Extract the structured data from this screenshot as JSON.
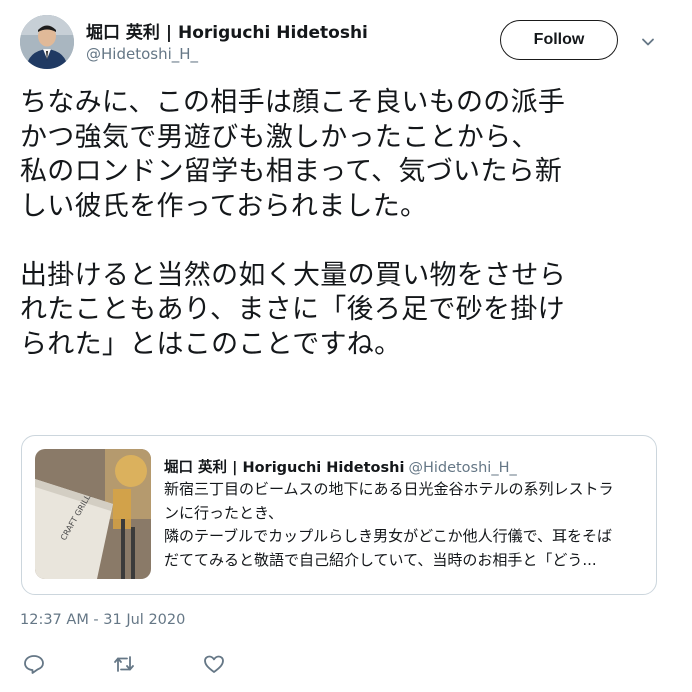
{
  "author": {
    "display_name": "堀口 英利 | Horiguchi Hidetoshi",
    "handle": "@Hidetoshi_H_"
  },
  "follow_label": "Follow",
  "tweet_lines": [
    "ちなみに、この相手は顔こそ良いものの派手",
    "かつ強気で男遊びも激しかったことから、",
    "私のロンドン留学も相まって、気づいたら新",
    "しい彼氏を作っておられました。",
    "",
    "出掛けると当然の如く大量の買い物をさせら",
    "れたこともあり、まさに「後ろ足で砂を掛け",
    "られた」とはこのことですね。"
  ],
  "quoted_tweet": {
    "display_name": "堀口 英利 | Horiguchi Hidetoshi",
    "handle": "@Hidetoshi_H_",
    "text_lines": [
      "新宿三丁目のビームスの地下にある日光金谷ホテルの系列レストラ",
      "ンに行ったとき、",
      "隣のテーブルでカップルらしき男女がどこか他人行儀で、耳をそば",
      "だててみると敬語で自己紹介していて、当時のお相手と「どう..."
    ],
    "thumb_text": "CRAFT GRILL"
  },
  "timestamp": "12:37 AM - 31 Jul 2020",
  "icons": {
    "reply": "reply-icon",
    "retweet": "retweet-icon",
    "like": "like-icon",
    "caret": "chevron-down-icon"
  },
  "colors": {
    "text": "#14171a",
    "secondary": "#657786",
    "border": "#ccd6dd",
    "action_icon": "#657786"
  }
}
